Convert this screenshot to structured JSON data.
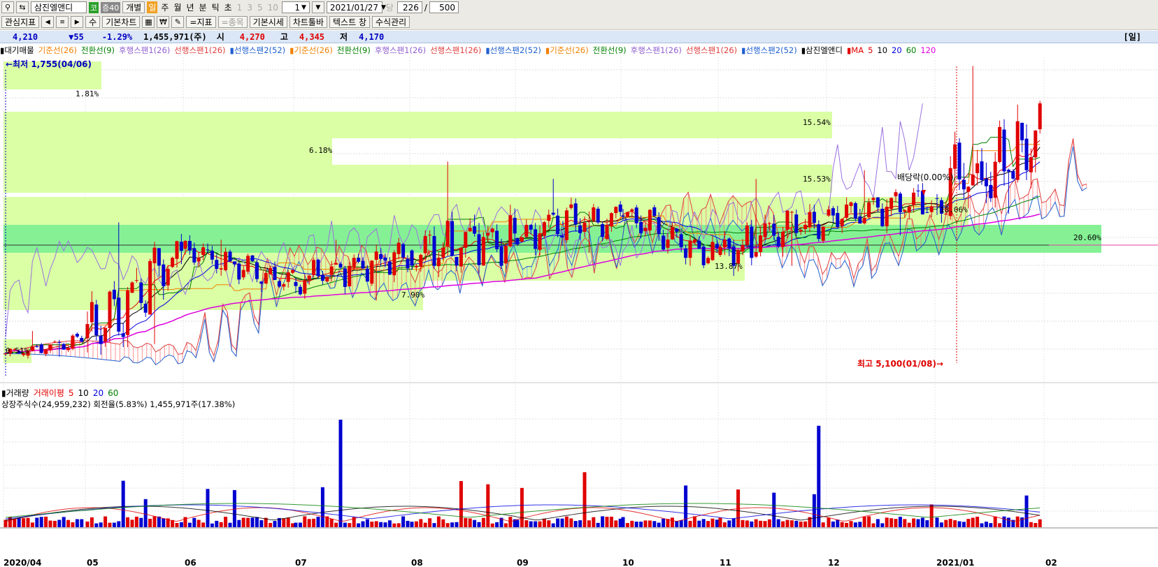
{
  "toolbar": {
    "stock_name": "삼진엘앤디",
    "market_badge": "코",
    "margin_badge": "증40",
    "unit_label": "개별",
    "periods": [
      "일",
      "주",
      "월",
      "년",
      "분",
      "틱",
      "초"
    ],
    "active_period": "일",
    "minute_options": [
      "1",
      "3",
      "5",
      "10"
    ],
    "step_value": "1",
    "date_value": "2021/01/27",
    "today_label": "당",
    "count_value": "226",
    "count_sep": "/",
    "count_total": "500"
  },
  "toolbar2": {
    "indicator_label": "관심지표",
    "step_label": "수",
    "basic_chart": "기본차트",
    "indicator_btn": "=지표",
    "item_btn": "=종목",
    "basic_quote": "기본시세",
    "chart_toolbar": "차트툴바",
    "text_window": "텍스트 창",
    "formula_mgr": "수식관리"
  },
  "quote": {
    "price": "4,210",
    "change": "▼55",
    "change_pct": "-1.29%",
    "volume": "1,455,971(주)",
    "open_label": "시",
    "open": "4,270",
    "high_label": "고",
    "high": "4,345",
    "low_label": "저",
    "low": "4,170",
    "period_label": "[일]"
  },
  "price_legend": [
    {
      "text": "▮대기매물",
      "color": "#000000"
    },
    {
      "text": "기준선(26)",
      "color": "#f08000"
    },
    {
      "text": "전환선(9)",
      "color": "#008000"
    },
    {
      "text": "후행스팬1(26)",
      "color": "#9060d0"
    },
    {
      "text": "선행스팬1(26)",
      "color": "#e04040"
    },
    {
      "text": "▮선행스팬2(52)",
      "color": "#2060d0"
    },
    {
      "text": "▮기준선(26)",
      "color": "#f08000"
    },
    {
      "text": "전환선(9)",
      "color": "#008000"
    },
    {
      "text": "후행스팬1(26)",
      "color": "#9060d0"
    },
    {
      "text": "선행스팬1(26)",
      "color": "#e04040"
    },
    {
      "text": "▮선행스팬2(52)",
      "color": "#2060d0"
    },
    {
      "text": "▮기준선(26)",
      "color": "#f08000"
    },
    {
      "text": "전환선(9)",
      "color": "#008000"
    },
    {
      "text": "후행스팬1(26)",
      "color": "#9060d0"
    },
    {
      "text": "선행스팬1(26)",
      "color": "#e04040"
    },
    {
      "text": "▮선행스팬2(52)",
      "color": "#2060d0"
    },
    {
      "text": "▮삼진엘앤디",
      "color": "#000000"
    },
    {
      "text": "▮MA",
      "color": "#e00000"
    },
    {
      "text": "5",
      "color": "#e00000"
    },
    {
      "text": "10",
      "color": "#000000"
    },
    {
      "text": "20",
      "color": "#0000e0"
    },
    {
      "text": "60",
      "color": "#008000"
    },
    {
      "text": "120",
      "color": "#e000e0"
    }
  ],
  "volume_legend": [
    {
      "text": "▮거래량",
      "color": "#000000"
    },
    {
      "text": "거래이평",
      "color": "#e00000"
    },
    {
      "text": "5",
      "color": "#e00000"
    },
    {
      "text": "10",
      "color": "#000000"
    },
    {
      "text": "20",
      "color": "#0000e0"
    },
    {
      "text": "60",
      "color": "#008000"
    }
  ],
  "shares_info": "상장주식수(24,959,232) 회전율(5.83%) 1,455,971주(17.38%)",
  "chart_data": {
    "type": "candlestick",
    "title": "삼진엘앤디",
    "low_marker": "←최저 1,755(04/06)",
    "high_marker": "최고 5,100(01/08)→",
    "dividend_marker": "배당락(0.00%)",
    "x_ticks": [
      "2020/04",
      "05",
      "06",
      "07",
      "08",
      "09",
      "10",
      "11",
      "12",
      "2021/01",
      "02"
    ],
    "volume_profile_pct": [
      "1.81%",
      "15.54%",
      "6.18%",
      "15.53%",
      "18.06%",
      "20.60%",
      "13.87%",
      "7.90%",
      "0.51%"
    ],
    "monthly_ohlc": [
      {
        "month": "2020/04",
        "open": 1780,
        "high": 2050,
        "low": 1755,
        "close": 1950
      },
      {
        "month": "05",
        "open": 1950,
        "high": 3300,
        "low": 1900,
        "close": 3000
      },
      {
        "month": "06",
        "open": 3000,
        "high": 3100,
        "low": 2500,
        "close": 2600
      },
      {
        "month": "07",
        "open": 2600,
        "high": 3100,
        "low": 2400,
        "close": 2950
      },
      {
        "month": "08",
        "open": 2950,
        "high": 4000,
        "low": 2800,
        "close": 3150
      },
      {
        "month": "09",
        "open": 3150,
        "high": 3800,
        "low": 2950,
        "close": 3400
      },
      {
        "month": "10",
        "open": 3400,
        "high": 3500,
        "low": 2800,
        "close": 2900
      },
      {
        "month": "11",
        "open": 2900,
        "high": 3800,
        "low": 2800,
        "close": 3350
      },
      {
        "month": "12",
        "open": 3350,
        "high": 3900,
        "low": 3150,
        "close": 3550
      },
      {
        "month": "2021/01",
        "open": 3550,
        "high": 5100,
        "low": 3400,
        "close": 4210
      }
    ],
    "volume_max_days": [
      "05 mid",
      "08 early",
      "09 late",
      "11 early",
      "2021/01 early"
    ]
  }
}
